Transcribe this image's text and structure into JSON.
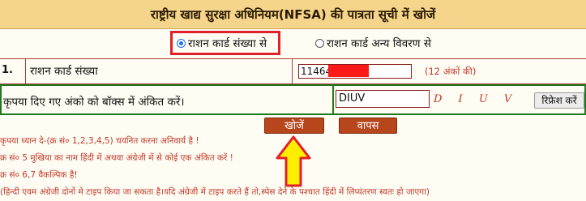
{
  "header": {
    "title": "राष्ट्रीय खाद्य सुरक्षा अधिनियम(NFSA) की पात्रता सूची में खोजें"
  },
  "search_mode": {
    "options": [
      {
        "label": "राशन कार्ड संख्या से",
        "selected": true
      },
      {
        "label": "राशन कार्ड अन्य विवरण से",
        "selected": false
      }
    ]
  },
  "ration_card_row": {
    "number": "1.",
    "label": "राशन कार्ड संख्या",
    "value": "11464",
    "hint": "(12 अंकों की)"
  },
  "captcha_row": {
    "label": "कृपया दिए गए अंको को बॉक्स में अंकित करें।",
    "value": "DIUV",
    "captcha_text": "D I U V",
    "refresh_label": "रिफ्रेश करें"
  },
  "actions": {
    "search_label": "खोजें",
    "back_label": "वापस"
  },
  "notes": [
    "कृपया ध्यान दे-(क्र सं० 1,2,3,4,5) चयनित करना अनिवार्य है !",
    "क्र सं० 5 मुखिया का नाम हिंदी में अथवा अंग्रेजी में से कोई एक अंकित करें !",
    "क्र सं० 6,7 वैकल्पिक है!",
    "(हिन्दी एवम अंग्रेजी दोनों मे टाइप किया जा सकता है।यदि अंग्रेजी में टाइप करते हैं तो,स्पेस देने के पश्चात हिंदी में लिप्यंतरण स्वतः हो जाएगा)"
  ],
  "colors": {
    "header_bg": "#f5d48b",
    "highlight_border": "#e0202a",
    "button_bg": "#b7461d",
    "note_text": "#c0392b",
    "arrow_fill": "#ffee00",
    "arrow_stroke": "#e0202a",
    "captcha_row_border": "#1f7a1f"
  },
  "icons": {
    "annotation_arrow": "up-arrow-icon"
  }
}
